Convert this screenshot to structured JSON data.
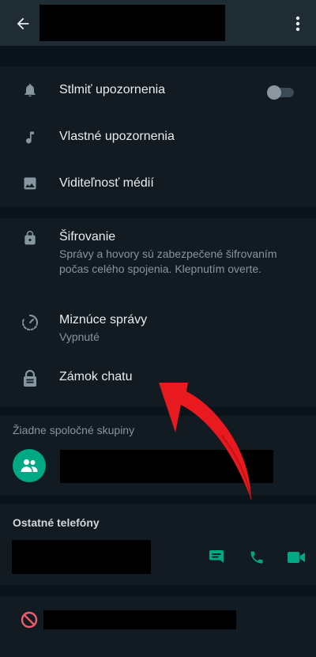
{
  "header": {
    "back_icon": "arrow-left-icon",
    "menu_icon": "more-vertical-icon"
  },
  "notifications_section": {
    "mute": {
      "label": "Stlmiť upozornenia",
      "icon": "bell-icon",
      "enabled": false
    },
    "custom": {
      "label": "Vlastné upozornenia",
      "icon": "music-note-icon"
    },
    "media": {
      "label": "Viditeľnosť médií",
      "icon": "image-icon"
    }
  },
  "privacy_section": {
    "encryption": {
      "title": "Šifrovanie",
      "description": "Správy a hovory sú zabezpečené šifrovaním počas celého spojenia. Klepnutím overte.",
      "icon": "lock-icon"
    },
    "disappearing": {
      "title": "Miznúce správy",
      "status": "Vypnuté",
      "icon": "timer-icon"
    },
    "chat_lock": {
      "title": "Zámok chatu",
      "icon": "chat-lock-icon"
    }
  },
  "groups_section": {
    "label": "Žiadne spoločné skupiny",
    "icon": "group-icon"
  },
  "phones_section": {
    "label": "Ostatné telefóny",
    "actions": [
      "message-icon",
      "phone-icon",
      "video-icon"
    ]
  },
  "block_section": {
    "icon": "block-icon"
  },
  "colors": {
    "accent": "#00a884",
    "danger": "#f15c6d",
    "annotation": "#e8191f"
  }
}
